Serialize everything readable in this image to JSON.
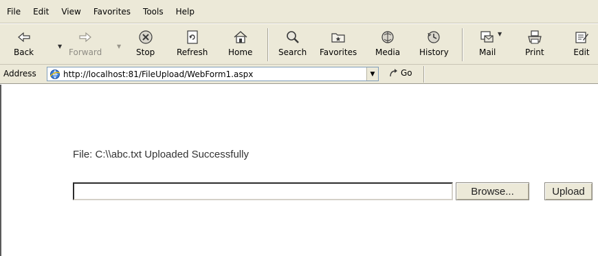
{
  "menubar": {
    "items": [
      "File",
      "Edit",
      "View",
      "Favorites",
      "Tools",
      "Help"
    ]
  },
  "toolbar": {
    "back_label": "Back",
    "forward_label": "Forward",
    "stop_label": "Stop",
    "refresh_label": "Refresh",
    "home_label": "Home",
    "search_label": "Search",
    "favorites_label": "Favorites",
    "media_label": "Media",
    "history_label": "History",
    "mail_label": "Mail",
    "print_label": "Print",
    "edit_label": "Edit"
  },
  "addressbar": {
    "label": "Address",
    "url": "http://localhost:81/FileUpload/WebForm1.aspx",
    "go_label": "Go"
  },
  "page": {
    "status_message": "File: C:\\\\abc.txt Uploaded Successfully",
    "file_input_value": "",
    "browse_label": "Browse...",
    "upload_label": "Upload"
  }
}
